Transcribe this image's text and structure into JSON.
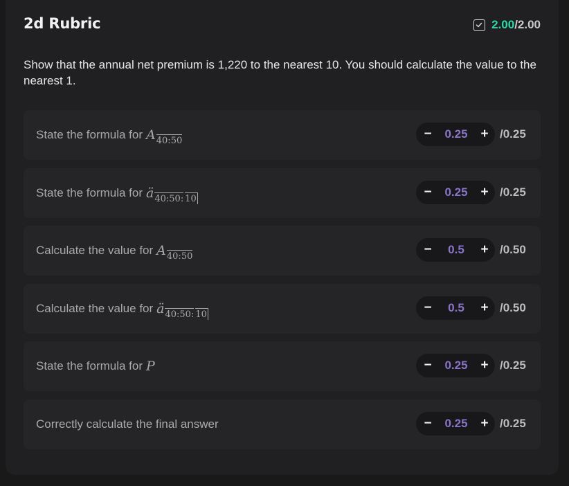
{
  "header": {
    "title": "2d Rubric",
    "score_earned": "2.00",
    "score_total": "/2.00"
  },
  "question": "Show that the annual net premium is 1,220 to the nearest 10. You should calculate the value to the nearest 1.",
  "criteria": [
    {
      "label": "State the formula for",
      "math_symbol": "A",
      "math_sub": "40:50",
      "math_angle": "",
      "value": "0.25",
      "max": "/0.25"
    },
    {
      "label": "State the formula for",
      "math_symbol": "ä",
      "math_sub": "40:50:",
      "math_angle": "10",
      "value": "0.25",
      "max": "/0.25"
    },
    {
      "label": "Calculate the value for",
      "math_symbol": "A",
      "math_sub": "40:50",
      "math_angle": "",
      "value": "0.5",
      "max": "/0.50"
    },
    {
      "label": "Calculate the value for",
      "math_symbol": "ä",
      "math_sub": "40:50:",
      "math_angle": "10",
      "value": "0.5",
      "max": "/0.50"
    },
    {
      "label": "State the formula for",
      "math_symbol": "P",
      "math_sub": "",
      "math_angle": "",
      "value": "0.25",
      "max": "/0.25"
    },
    {
      "label": "Correctly calculate the final answer",
      "math_symbol": "",
      "math_sub": "",
      "math_angle": "",
      "value": "0.25",
      "max": "/0.25"
    }
  ],
  "stepper": {
    "minus": "−",
    "plus": "+"
  },
  "colors": {
    "earned": "#2fd6a8",
    "value": "#8a74c9"
  },
  "icons": {
    "score": "checkbox-check-icon"
  }
}
